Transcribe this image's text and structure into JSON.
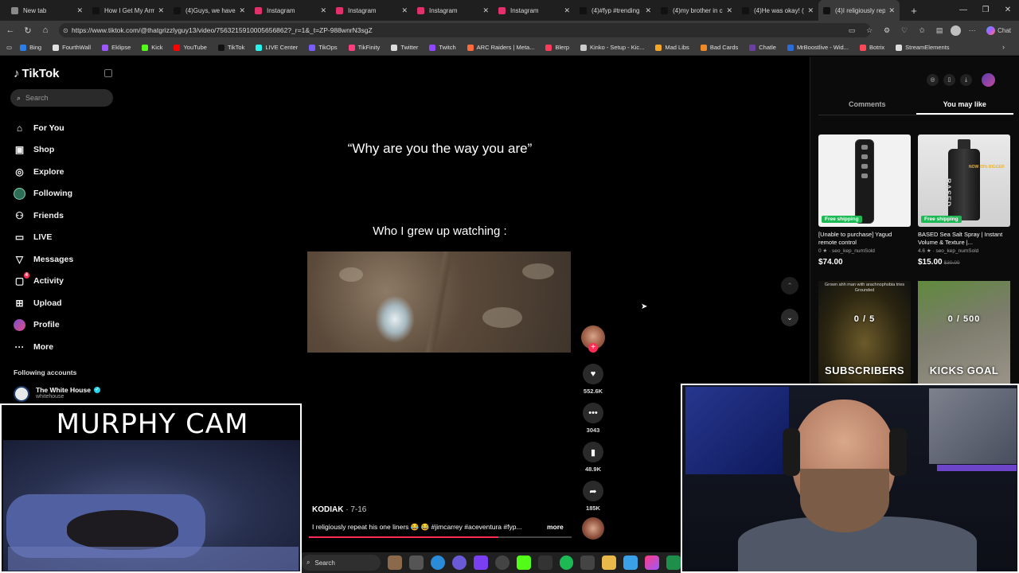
{
  "browser": {
    "tabs": [
      {
        "title": "New tab",
        "icon": "new-tab-icon",
        "color": "#8a8a8a",
        "active": false
      },
      {
        "title": "How I Get My Armi",
        "icon": "tiktok-icon",
        "color": "#111111",
        "active": false
      },
      {
        "title": "(4)Guys, we have n",
        "icon": "tiktok-icon",
        "color": "#111111",
        "active": false
      },
      {
        "title": "Instagram",
        "icon": "instagram-icon",
        "color": "#e1306c",
        "active": false
      },
      {
        "title": "Instagram",
        "icon": "instagram-icon",
        "color": "#e1306c",
        "active": false
      },
      {
        "title": "Instagram",
        "icon": "instagram-icon",
        "color": "#e1306c",
        "active": false
      },
      {
        "title": "Instagram",
        "icon": "instagram-icon",
        "color": "#e1306c",
        "active": false
      },
      {
        "title": "(4)#fyp #trending #",
        "icon": "tiktok-icon",
        "color": "#111111",
        "active": false
      },
      {
        "title": "(4)my brother in ch",
        "icon": "tiktok-icon",
        "color": "#111111",
        "active": false
      },
      {
        "title": "(4)He was okay! (v",
        "icon": "tiktok-icon",
        "color": "#111111",
        "active": false
      },
      {
        "title": "(4)I religiously repe",
        "icon": "tiktok-icon",
        "color": "#111111",
        "active": true
      }
    ],
    "new_tab_label": "+",
    "url": "https://www.tiktok.com/@thatgrizzlyguy13/video/7563215910005656862?_r=1&_t=ZP-988wnrN3sgZ",
    "chat_label": "Chat",
    "bookmarks": [
      {
        "label": "Bing",
        "color": "#2b7de9"
      },
      {
        "label": "FourthWall",
        "color": "#e0e0e0"
      },
      {
        "label": "Eklipse",
        "color": "#9b59ff"
      },
      {
        "label": "Kick",
        "color": "#53fc18"
      },
      {
        "label": "YouTube",
        "color": "#ff0000"
      },
      {
        "label": "TikTok",
        "color": "#111111"
      },
      {
        "label": "LIVE Center",
        "color": "#25f4ee"
      },
      {
        "label": "TikOps",
        "color": "#7a5cff"
      },
      {
        "label": "TikFinity",
        "color": "#ff3d7f"
      },
      {
        "label": "Twitter",
        "color": "#dddddd"
      },
      {
        "label": "Twitch",
        "color": "#9146ff"
      },
      {
        "label": "ARC Raiders | Meta...",
        "color": "#ff6a3d"
      },
      {
        "label": "Blerp",
        "color": "#ff3b5c"
      },
      {
        "label": "Kinko - Setup - Kic...",
        "color": "#cccccc"
      },
      {
        "label": "Mad Libs",
        "color": "#f5a623"
      },
      {
        "label": "Bad Cards",
        "color": "#f08a24"
      },
      {
        "label": "Chatle",
        "color": "#6b3fa0"
      },
      {
        "label": "MrBoostlive - Wid...",
        "color": "#2b6cd9"
      },
      {
        "label": "Botrix",
        "color": "#ff4757"
      },
      {
        "label": "StreamElements",
        "color": "#dddddd"
      }
    ]
  },
  "tiktok": {
    "logo": "TikTok",
    "search_placeholder": "Search",
    "nav": [
      {
        "label": "For You",
        "icon": "home-icon",
        "glyph": "⌂"
      },
      {
        "label": "Shop",
        "icon": "shop-icon",
        "glyph": "▣"
      },
      {
        "label": "Explore",
        "icon": "compass-icon",
        "glyph": "◎"
      },
      {
        "label": "Following",
        "icon": "following-avatar-icon",
        "glyph": ""
      },
      {
        "label": "Friends",
        "icon": "friends-icon",
        "glyph": "⚇"
      },
      {
        "label": "LIVE",
        "icon": "live-icon",
        "glyph": "▭"
      },
      {
        "label": "Messages",
        "icon": "messages-icon",
        "glyph": "▽"
      },
      {
        "label": "Activity",
        "icon": "activity-icon",
        "glyph": "▢",
        "badge": "4"
      },
      {
        "label": "Upload",
        "icon": "upload-icon",
        "glyph": "⊞"
      },
      {
        "label": "Profile",
        "icon": "profile-avatar-icon",
        "glyph": ""
      },
      {
        "label": "More",
        "icon": "more-icon",
        "glyph": "···"
      }
    ],
    "following_accounts_title": "Following accounts",
    "following_accounts": [
      {
        "name": "The White House",
        "handle": "whitehouse"
      }
    ]
  },
  "video": {
    "caption_top": "“Why are you the way you are”",
    "caption_mid": "Who I grew up watching :",
    "author": "KODIAK",
    "date": "· 7-16",
    "description": "I religiously repeat his one liners 😂 😂 #jimcarrey #aceventura #fyp...",
    "more_label": "more",
    "progress": 0.72,
    "likes": "552.6K",
    "comments": "3043",
    "saves": "48.9K",
    "shares": "185K"
  },
  "right_panel": {
    "tabs": [
      "Comments",
      "You may like"
    ],
    "active_tab": "You may like",
    "products": [
      {
        "title": "[Unable to purchase] Yagud remote control",
        "rating": "0 ★ · seo_kep_numSold",
        "price": "$74.00",
        "old_price": "",
        "badge": "Free shipping"
      },
      {
        "title": "BASED Sea Salt Spray | Instant Volume & Texture |...",
        "rating": "4.6 ★ · seo_kep_numSold",
        "price": "$15.00",
        "old_price": "$30.00",
        "badge": "Free shipping",
        "bottle_label": "BASED",
        "bottle_tag": "NOW 29% BIGGER"
      }
    ],
    "goals": [
      {
        "caption": "Grown ahh man with arachnophobia tries Grounded",
        "count": "0 / 5",
        "label": "SUBSCRIBERS"
      },
      {
        "count": "0 / 500",
        "label": "KICKS GOAL"
      }
    ]
  },
  "overlays": {
    "left_cam_title": "MURPHY CAM"
  },
  "taskbar": {
    "search_label": "Search"
  }
}
